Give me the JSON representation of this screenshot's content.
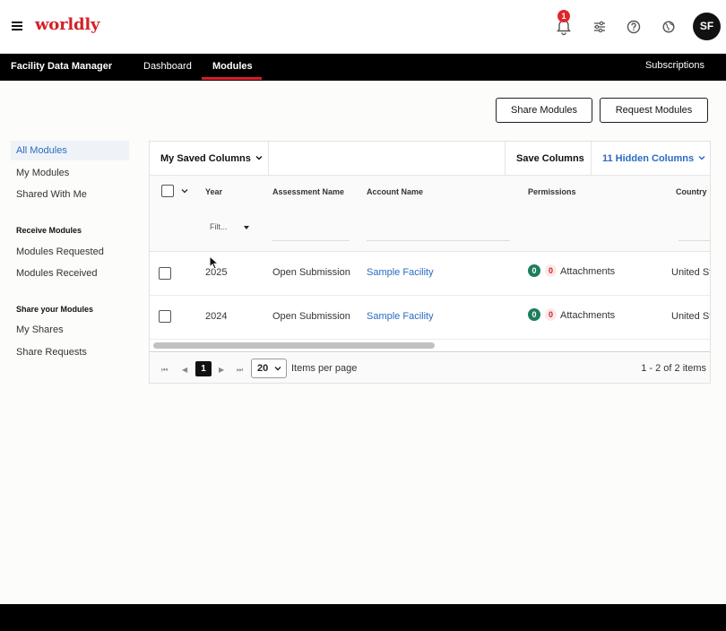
{
  "header": {
    "logo": "worldly",
    "notification_count": "1",
    "avatar_initials": "SF",
    "icons": [
      "menu-icon",
      "bell-icon",
      "sliders-icon",
      "help-icon",
      "globe-icon"
    ]
  },
  "nav": {
    "app_title": "Facility Data Manager",
    "tabs": [
      {
        "label": "Dashboard",
        "active": false
      },
      {
        "label": "Modules",
        "active": true
      }
    ],
    "right_link": "Subscriptions"
  },
  "actions": {
    "share_modules": "Share Modules",
    "request_modules": "Request Modules"
  },
  "sidebar": {
    "items": [
      {
        "label": "All Modules",
        "active": true
      },
      {
        "label": "My Modules"
      },
      {
        "label": "Shared With Me"
      }
    ],
    "receive_heading": "Receive Modules",
    "receive_items": [
      {
        "label": "Modules Requested"
      },
      {
        "label": "Modules Received"
      }
    ],
    "share_heading": "Share your Modules",
    "share_items": [
      {
        "label": "My Shares"
      },
      {
        "label": "Share Requests"
      }
    ]
  },
  "table": {
    "toolbar": {
      "saved_columns": "My Saved Columns",
      "save_columns": "Save Columns",
      "hidden_columns": "11 Hidden Columns"
    },
    "columns": [
      "Year",
      "Assessment Name",
      "Account Name",
      "Permissions",
      "Country"
    ],
    "filter_placeholder": "Filt...",
    "rows": [
      {
        "year": "2025",
        "assessment": "Open Submission",
        "account": "Sample Facility",
        "perm_green": "0",
        "perm_red": "0",
        "perm_label": "Attachments",
        "country": "United St"
      },
      {
        "year": "2024",
        "assessment": "Open Submission",
        "account": "Sample Facility",
        "perm_green": "0",
        "perm_red": "0",
        "perm_label": "Attachments",
        "country": "United St"
      }
    ],
    "pagination": {
      "current_page": "1",
      "per_page": "20",
      "per_page_label": "Items per page",
      "summary": "1 - 2 of 2 items"
    }
  },
  "colors": {
    "brand_red": "#d42027",
    "link_blue": "#2a6bc4",
    "permission_green": "#1e7d5a"
  }
}
